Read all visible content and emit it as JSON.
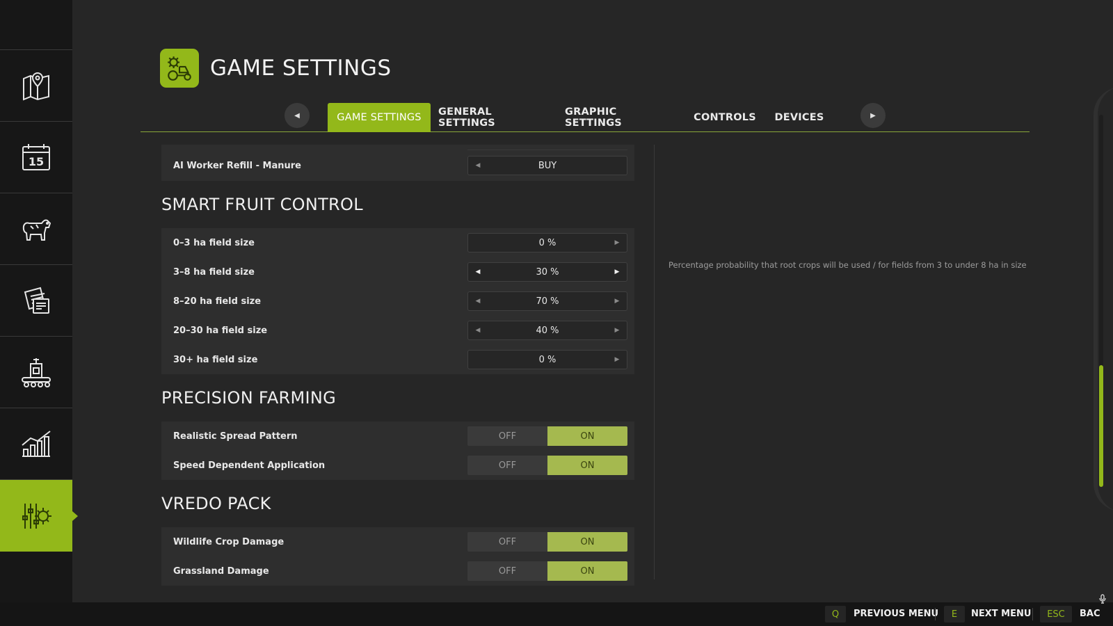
{
  "header": {
    "title": "GAME SETTINGS",
    "icon": "tractor-gear-icon"
  },
  "sidebar": {
    "items": [
      {
        "icon": "map-pin-icon"
      },
      {
        "icon": "calendar-icon",
        "label": "15"
      },
      {
        "icon": "cow-icon"
      },
      {
        "icon": "contracts-icon"
      },
      {
        "icon": "production-icon"
      },
      {
        "icon": "statistics-icon"
      },
      {
        "icon": "settings-sliders-icon",
        "active": true
      }
    ]
  },
  "tabs": [
    {
      "label": "GAME SETTINGS",
      "active": true
    },
    {
      "label": "GENERAL SETTINGS"
    },
    {
      "label": "GRAPHIC SETTINGS"
    },
    {
      "label": "CONTROLS"
    },
    {
      "label": "DEVICES"
    }
  ],
  "settings": {
    "top_row": {
      "label": "AI Worker Refill - Manure",
      "value": "BUY"
    },
    "smart_fruit": {
      "title": "SMART FRUIT CONTROL",
      "rows": [
        {
          "label": "0–3 ha field size",
          "value": "0 %"
        },
        {
          "label": "3–8 ha field size",
          "value": "30 %"
        },
        {
          "label": "8–20 ha field size",
          "value": "70 %"
        },
        {
          "label": "20–30 ha field size",
          "value": "40 %"
        },
        {
          "label": "30+ ha field size",
          "value": "0 %"
        }
      ]
    },
    "precision": {
      "title": "PRECISION FARMING",
      "rows": [
        {
          "label": "Realistic Spread Pattern",
          "off": "OFF",
          "on": "ON"
        },
        {
          "label": "Speed Dependent Application",
          "off": "OFF",
          "on": "ON"
        }
      ]
    },
    "vredo": {
      "title": "VREDO PACK",
      "rows": [
        {
          "label": "Wildlife Crop Damage",
          "off": "OFF",
          "on": "ON"
        },
        {
          "label": "Grassland Damage",
          "off": "OFF",
          "on": "ON"
        }
      ]
    }
  },
  "description": "Percentage probability that root crops will be used / for fields from 3 to under 8 ha in size",
  "footer": {
    "prev_key": "Q",
    "prev_label": "PREVIOUS MENU",
    "next_key": "E",
    "next_label": "NEXT MENU",
    "back_key": "ESC",
    "back_label": "BAC"
  },
  "colors": {
    "accent": "#93b81a",
    "toggle_on": "#a5b94f",
    "background": "#262626",
    "sidebar": "#171717"
  }
}
